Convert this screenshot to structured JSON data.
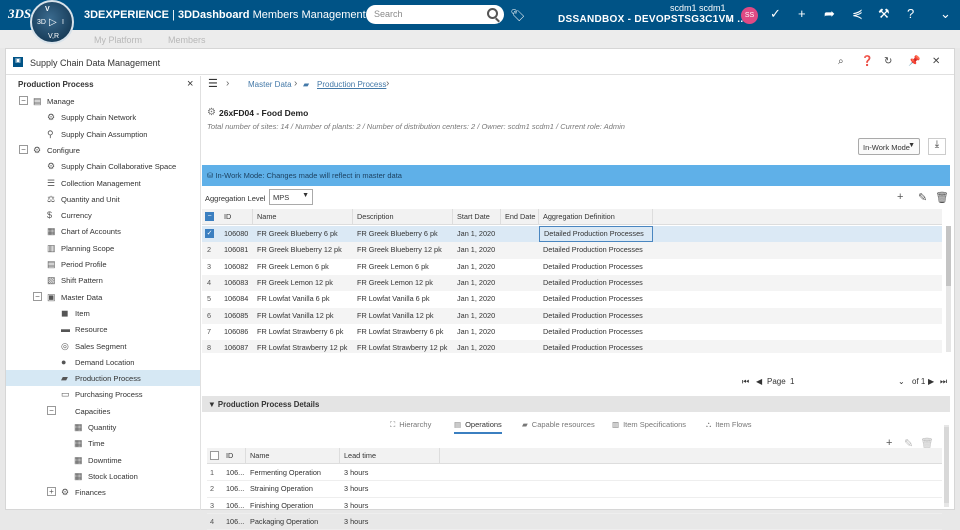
{
  "topbar": {
    "brand": "3DEXPERIENCE",
    "separator": " | ",
    "product": "3DDashboard",
    "app": "Members Management",
    "search_placeholder": "Search",
    "user": "scdm1 scdm1",
    "tenant": "DSSANDBOX - DEVOPSTSG3C1VM ...",
    "avatar_initials": "SS",
    "compass": {
      "top": "V",
      "left": "3D",
      "right": "I",
      "bottom": "V,R"
    },
    "ds_logo": "3DS"
  },
  "subbar": {
    "tab1": "My Platform",
    "tab2": "Members"
  },
  "widget": {
    "title": "Supply Chain Data Management"
  },
  "sidebar": {
    "heading": "Production Process",
    "close": "×",
    "items": [
      {
        "label": "Manage",
        "expander": "−",
        "icon": "▤"
      },
      {
        "label": "Supply Chain Network",
        "icon": "⚙"
      },
      {
        "label": "Supply Chain Assumption",
        "icon": "⚲"
      },
      {
        "label": "Configure",
        "expander": "−",
        "icon": "⚙"
      },
      {
        "label": "Supply Chain Collaborative Space",
        "icon": "⚙"
      },
      {
        "label": "Collection Management",
        "icon": "☰"
      },
      {
        "label": "Quantity and Unit",
        "icon": "⚖"
      },
      {
        "label": "Currency",
        "icon": "$"
      },
      {
        "label": "Chart of Accounts",
        "icon": "▦"
      },
      {
        "label": "Planning Scope",
        "icon": "▥"
      },
      {
        "label": "Period Profile",
        "icon": "▤"
      },
      {
        "label": "Shift Pattern",
        "icon": "▧"
      },
      {
        "label": "Master Data",
        "expander": "−",
        "icon": "▣"
      },
      {
        "label": "Item",
        "icon": "◼"
      },
      {
        "label": "Resource",
        "icon": "▬"
      },
      {
        "label": "Sales Segment",
        "icon": "◎"
      },
      {
        "label": "Demand Location",
        "icon": "●"
      },
      {
        "label": "Production Process",
        "icon": "▰"
      },
      {
        "label": "Purchasing Process",
        "icon": "▭"
      },
      {
        "label": "Capacities",
        "expander": "−",
        "icon": ""
      },
      {
        "label": "Quantity",
        "icon": "▦"
      },
      {
        "label": "Time",
        "icon": "▦"
      },
      {
        "label": "Downtime",
        "icon": "▦"
      },
      {
        "label": "Stock Location",
        "icon": "▦"
      },
      {
        "label": "Finances",
        "expander": "+",
        "icon": "⚙"
      }
    ]
  },
  "breadcrumb": {
    "menu": "☰",
    "level1": "Master Data",
    "level2": "Production Process"
  },
  "context": {
    "name": "26xFD04 - Food Demo",
    "summary": "Total number of sites: 14 / Number of plants: 2 / Number of distribution centers: 2 / Owner: scdm1 scdm1 / Current role: Admin",
    "mode": "In-Work Mode",
    "banner": "In-Work Mode: Changes made will reflect in master data"
  },
  "aggregation": {
    "label": "Aggregation Level",
    "value": "MPS"
  },
  "grid": {
    "columns": [
      "ID",
      "Name",
      "Description",
      "Start Date",
      "End Date",
      "Aggregation Definition"
    ],
    "rows": [
      {
        "num": "1",
        "id": "106080",
        "name": "FR Greek Blueberry 6 pk",
        "desc": "FR Greek Blueberry 6 pk",
        "start": "Jan 1, 2020",
        "end": "",
        "agg": "Detailed Production Processes"
      },
      {
        "num": "2",
        "id": "106081",
        "name": "FR Greek Blueberry 12 pk",
        "desc": "FR Greek Blueberry 12 pk",
        "start": "Jan 1, 2020",
        "end": "",
        "agg": "Detailed Production Processes"
      },
      {
        "num": "3",
        "id": "106082",
        "name": "FR Greek Lemon 6 pk",
        "desc": "FR Greek Lemon 6 pk",
        "start": "Jan 1, 2020",
        "end": "",
        "agg": "Detailed Production Processes"
      },
      {
        "num": "4",
        "id": "106083",
        "name": "FR Greek Lemon 12 pk",
        "desc": "FR Greek Lemon 12 pk",
        "start": "Jan 1, 2020",
        "end": "",
        "agg": "Detailed Production Processes"
      },
      {
        "num": "5",
        "id": "106084",
        "name": "FR Lowfat Vanilla 6 pk",
        "desc": "FR Lowfat Vanilla 6 pk",
        "start": "Jan 1, 2020",
        "end": "",
        "agg": "Detailed Production Processes"
      },
      {
        "num": "6",
        "id": "106085",
        "name": "FR Lowfat Vanilla 12 pk",
        "desc": "FR Lowfat Vanilla 12 pk",
        "start": "Jan 1, 2020",
        "end": "",
        "agg": "Detailed Production Processes"
      },
      {
        "num": "7",
        "id": "106086",
        "name": "FR Lowfat Strawberry 6 pk",
        "desc": "FR Lowfat Strawberry 6 pk",
        "start": "Jan 1, 2020",
        "end": "",
        "agg": "Detailed Production Processes"
      },
      {
        "num": "8",
        "id": "106087",
        "name": "FR Lowfat Strawberry 12 pk",
        "desc": "FR Lowfat Strawberry 12 pk",
        "start": "Jan 1, 2020",
        "end": "",
        "agg": "Detailed Production Processes"
      }
    ]
  },
  "pager": {
    "label": "Page",
    "current": "1",
    "of": "of 1"
  },
  "details": {
    "title": "Production Process Details",
    "tabs": [
      "Hierarchy",
      "Operations",
      "Capable resources",
      "Item Specifications",
      "Item Flows"
    ],
    "columns": [
      "ID",
      "Name",
      "Lead time"
    ],
    "rows": [
      {
        "num": "1",
        "id": "106...",
        "name": "Fermenting Operation",
        "lead": "3 hours"
      },
      {
        "num": "2",
        "id": "106...",
        "name": "Straining Operation",
        "lead": "3 hours"
      },
      {
        "num": "3",
        "id": "106...",
        "name": "Finishing Operation",
        "lead": "3 hours"
      },
      {
        "num": "4",
        "id": "106...",
        "name": "Packaging Operation",
        "lead": "3 hours"
      }
    ]
  },
  "colors": {
    "topbar": "#005386",
    "banner": "#5fb0e8",
    "selection": "#d6e8f4",
    "accent": "#3b7fc0"
  }
}
